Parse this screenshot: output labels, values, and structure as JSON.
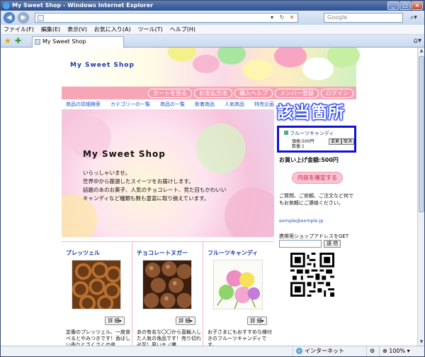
{
  "window": {
    "title": "My Sweet Shop - Windows Internet Explorer",
    "minimize": "_",
    "maximize": "□",
    "close": "×"
  },
  "address": {
    "url": "",
    "search_placeholder": "Google"
  },
  "menu": [
    "ファイル(F)",
    "編集(E)",
    "表示(V)",
    "お気に入り(A)",
    "ツール(T)",
    "ヘルプ(H)"
  ],
  "tab": {
    "label": "My Sweet Shop"
  },
  "site": {
    "logo": "My Sweet Shop",
    "topnav": [
      "カートを見る",
      "お支払方法",
      "購入ヘルプ",
      "メンバー登録",
      "ログイン"
    ],
    "catnav": [
      "商品の詳細検索",
      "カテゴリーの一覧",
      "商品の一覧",
      "新着商品",
      "人気商品",
      "特売企画"
    ],
    "hero": {
      "title": "My Sweet Shop",
      "lines": [
        "いらっしゃいませ。",
        "世界中から厳選したスイーツをお届けします。",
        "話題のあのお菓子、人気のチョコレート、見た目もかわいい",
        "キャンディなど種類も数も豊富に取り揃えています。"
      ]
    },
    "products": [
      {
        "name": "プレッツェル",
        "detail": "詳 細▸",
        "desc": "定番のプレッツェル、一度食べるとやみつきです！香ばしい香りとさくさくの食"
      },
      {
        "name": "チョコレートヌガー",
        "detail": "詳 細▸",
        "desc": "あの有名な〇〇から直輸入した人気の逸品です！売り切れ必至！早いモノ勝"
      },
      {
        "name": "フルーツキャンディ",
        "detail": "詳 細▸",
        "desc": "お子さまにもおすすめな様付きのフルーツキャンディです。"
      }
    ],
    "side": {
      "cart_item": "フルーツキャンディ",
      "cart_price": "価格:500円",
      "cart_qty": "数量:1",
      "change_btn": "変更",
      "cancel_btn": "取消",
      "total": "お買い上げ金額:500円",
      "confirm": "内容を確定する",
      "contact": "ご質問、ご依頼、ご注文など何でもお気軽にご連絡ください。",
      "email": "exmple@exmple.jp",
      "mobile_label": "携帯用ショップアドレスをGET",
      "mobile_send": "送 信"
    },
    "callout": "該当箇所"
  },
  "status": {
    "zone": "インターネット",
    "zoom": "100%"
  }
}
